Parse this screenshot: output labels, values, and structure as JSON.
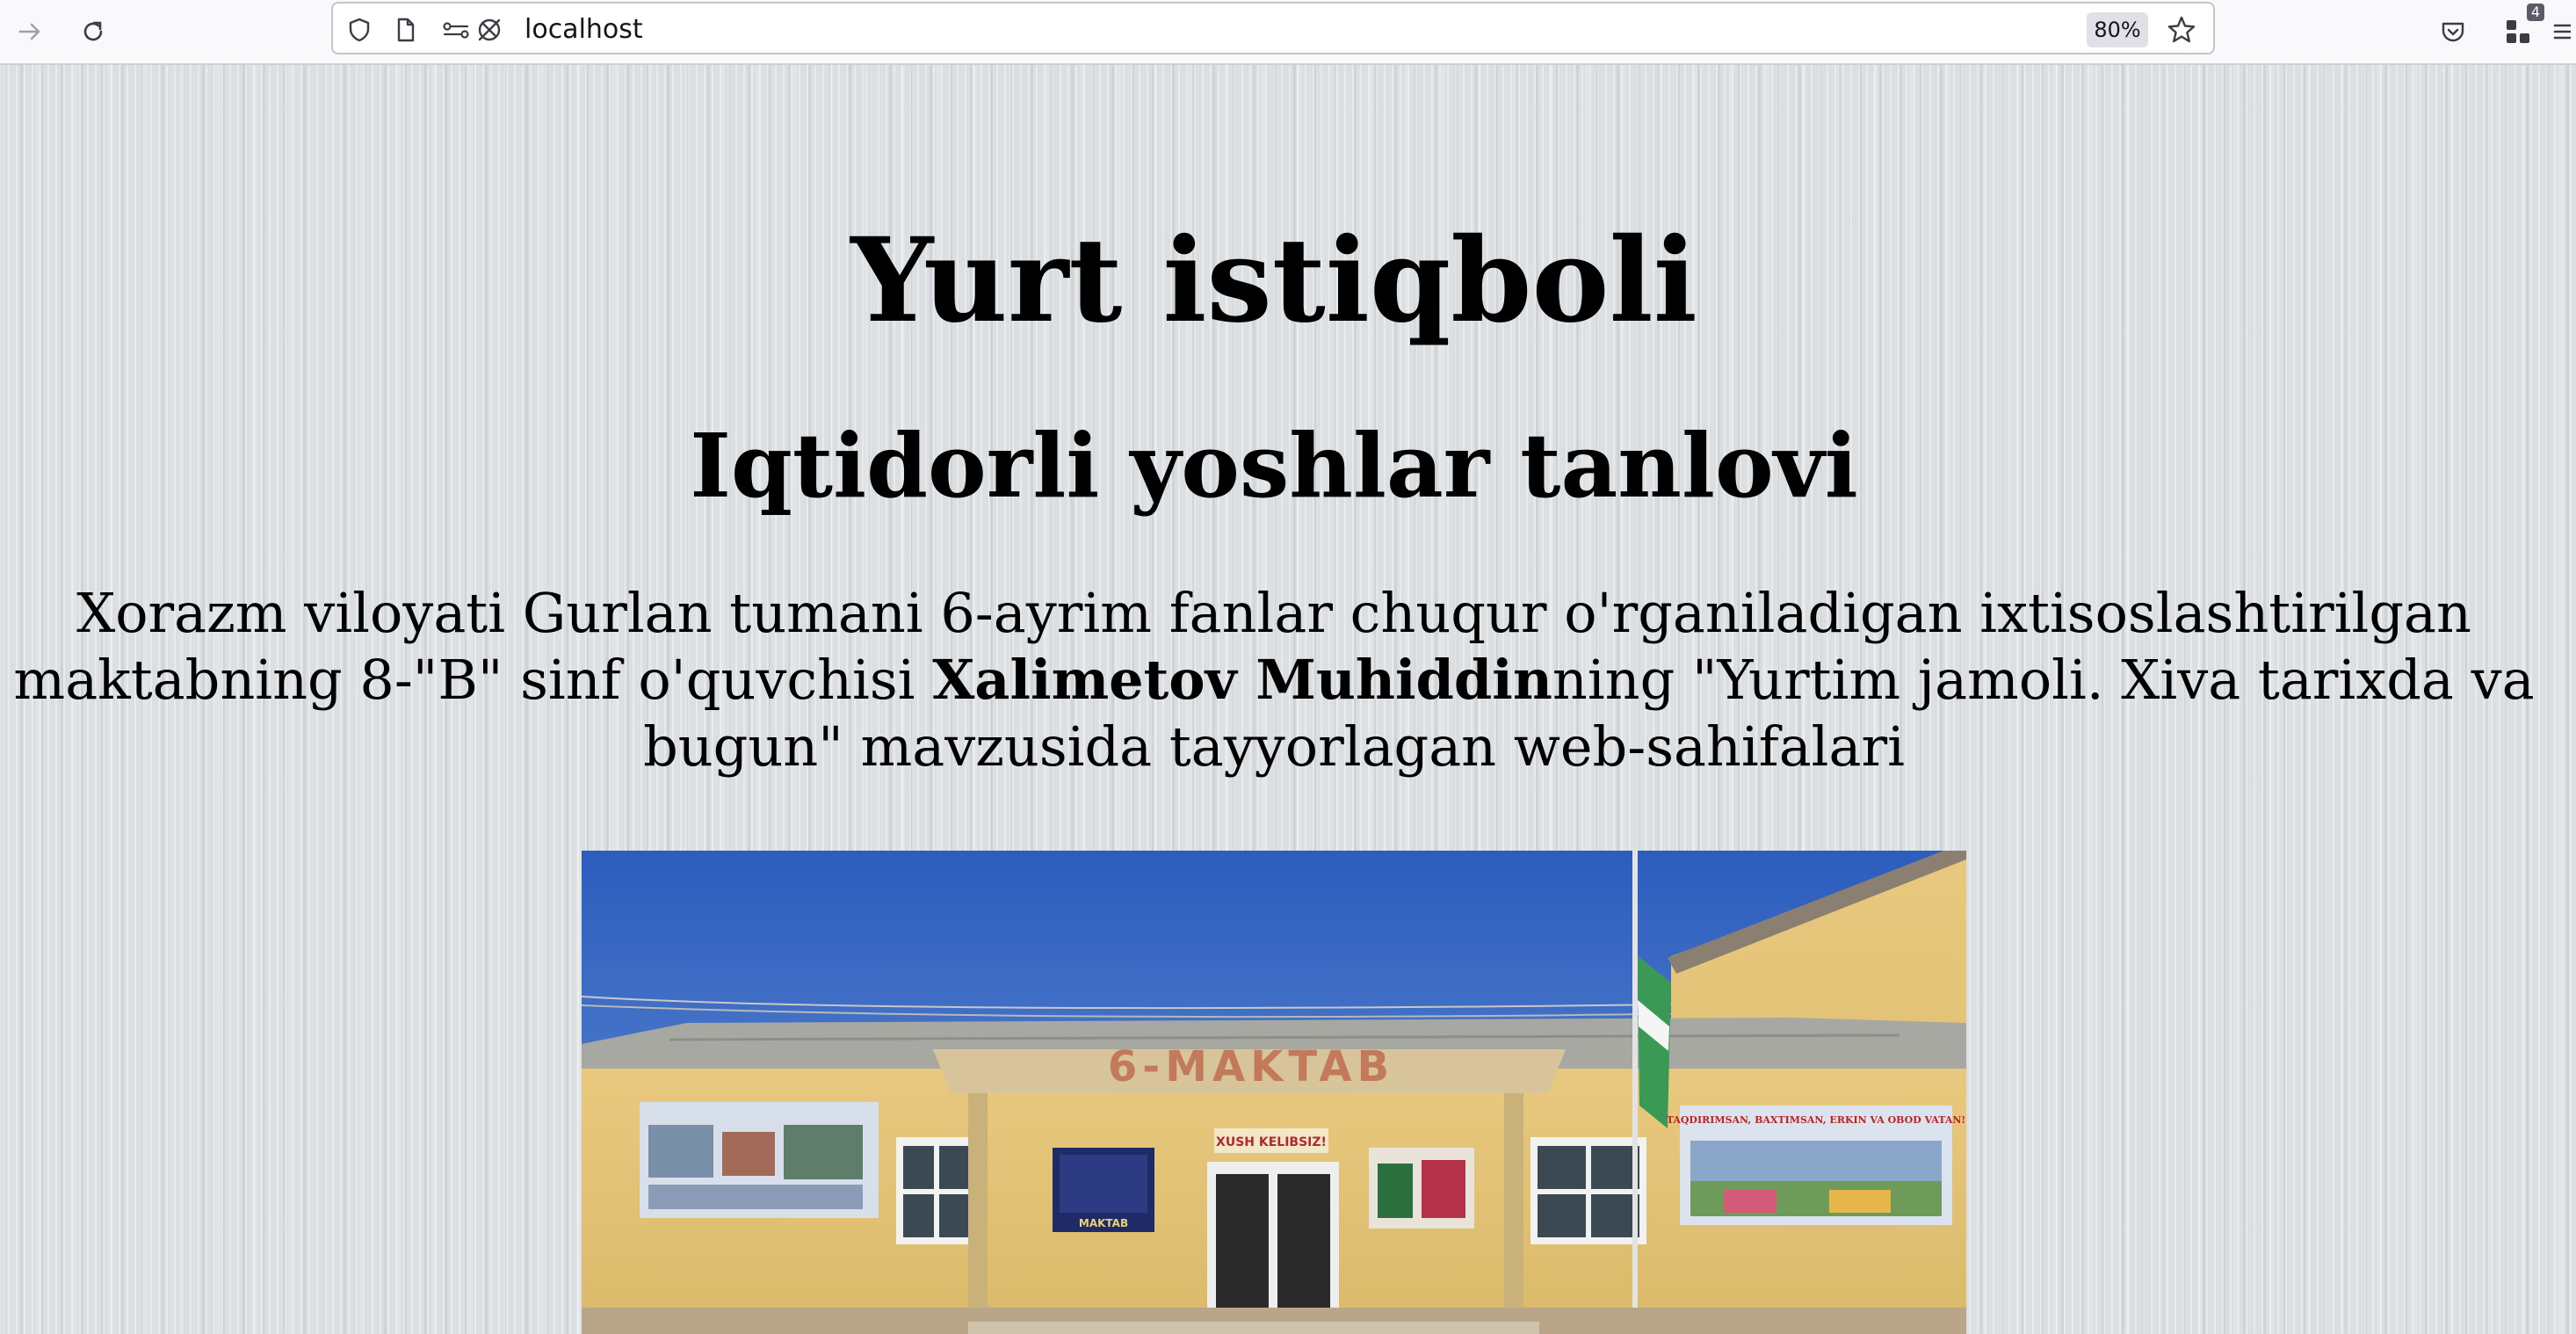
{
  "browser": {
    "url": "localhost",
    "zoom": "80%",
    "extensions_badge": "4"
  },
  "page": {
    "heading": "Yurt istiqboli",
    "subheading": "Iqtidorli yoshlar tanlovi",
    "intro_before": "Xorazm viloyati Gurlan tumani 6-ayrim fanlar chuqur o'rganiladigan ixtisoslashtirilgan maktabning 8-\"B\" sinf o'quvchisi ",
    "intro_name": "Xalimetov Muhiddin",
    "intro_after": "ning \"Yurtim jamoli. Xiva tarixda va bugun\" mavzusida tayyorlagan web-sahifalari",
    "photo": {
      "school_sign": "6-MAKTAB",
      "welcome_sign": "XUSH KELIBSIZ!",
      "plaque_text": "MAKTAB",
      "banner_right": "TAQDIRIMSAN, BAXTIMSAN, ERKIN VA OBOD VATAN!"
    }
  },
  "icons": {
    "forward": "arrow-right-icon",
    "reload": "reload-icon",
    "shield": "shield-icon",
    "page": "page-icon",
    "permissions": "permissions-icon",
    "tracking": "tracking-off-icon",
    "bookmark": "star-icon",
    "pocket": "pocket-icon",
    "extensions": "extensions-icon",
    "menu": "menu-icon"
  }
}
